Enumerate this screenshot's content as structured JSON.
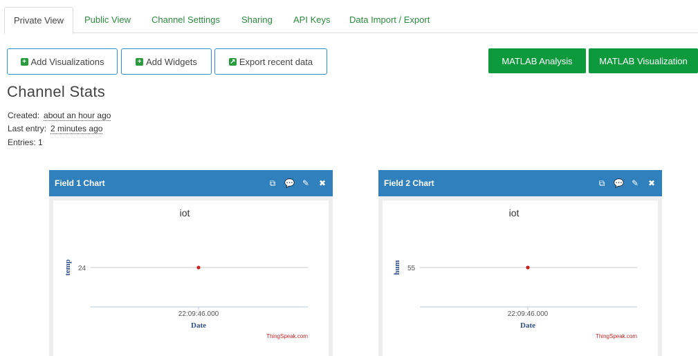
{
  "tabs": [
    "Private View",
    "Public View",
    "Channel Settings",
    "Sharing",
    "API Keys",
    "Data Import / Export"
  ],
  "toolbar": {
    "add_visualizations": "Add Visualizations",
    "add_widgets": "Add Widgets",
    "export_recent": "Export recent data",
    "matlab_analysis": "MATLAB Analysis",
    "matlab_visualization": "MATLAB Visualization"
  },
  "stats": {
    "title": "Channel Stats",
    "created_label": "Created:",
    "created_value": "about an hour ago",
    "last_entry_label": "Last entry:",
    "last_entry_value": "2 minutes ago",
    "entries_label": "Entries:",
    "entries_value": "1"
  },
  "colors": {
    "accent": "#0d9a3d",
    "panel_header": "#2f80bd",
    "point": "#cc1f1f"
  },
  "charts": [
    {
      "panel_title": "Field 1 Chart",
      "chart_title": "iot",
      "ylabel": "temp",
      "y_tick": "24",
      "x_tick": "22:09:46.000",
      "xlabel": "Date",
      "credit": "ThingSpeak.com"
    },
    {
      "panel_title": "Field 2 Chart",
      "chart_title": "iot",
      "ylabel": "hum",
      "y_tick": "55",
      "x_tick": "22:09:46.000",
      "xlabel": "Date",
      "credit": "ThingSpeak.com"
    }
  ],
  "chart_data": [
    {
      "type": "line",
      "title": "iot",
      "xlabel": "Date",
      "ylabel": "temp",
      "series": [
        {
          "x": [
            "22:09:46.000"
          ],
          "values": [
            24
          ]
        }
      ]
    },
    {
      "type": "line",
      "title": "iot",
      "xlabel": "Date",
      "ylabel": "hum",
      "series": [
        {
          "x": [
            "22:09:46.000"
          ],
          "values": [
            55
          ]
        }
      ]
    }
  ],
  "panel_icons": [
    "external-link-icon",
    "comment-icon",
    "pencil-icon",
    "close-icon"
  ]
}
